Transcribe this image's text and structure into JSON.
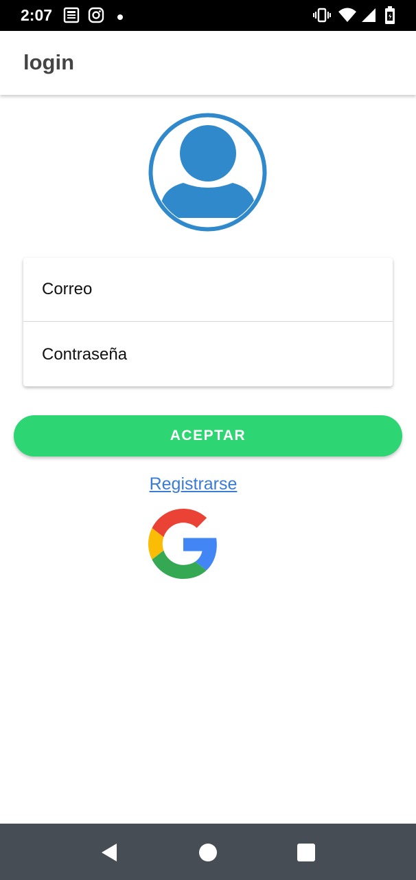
{
  "status_bar": {
    "time": "2:07",
    "left_icons": [
      "news-icon",
      "instagram-icon",
      "notification-dot-icon"
    ],
    "right_icons": [
      "vibrate-icon",
      "wifi-icon",
      "signal-icon",
      "battery-icon"
    ]
  },
  "app_bar": {
    "title": "login"
  },
  "avatar": {
    "icon": "user-avatar-icon",
    "color": "#3089CB"
  },
  "form": {
    "email_placeholder": "Correo",
    "password_placeholder": "Contraseña"
  },
  "accept_button": {
    "label": "ACEPTAR",
    "color": "#2ED573"
  },
  "register_link": {
    "label": "Registrarse",
    "color": "#3A7BD5"
  },
  "google_signin": {
    "icon": "google-logo-icon"
  },
  "nav_bar": {
    "buttons": [
      "back-icon",
      "home-icon",
      "recents-icon"
    ],
    "color": "#474D54"
  }
}
